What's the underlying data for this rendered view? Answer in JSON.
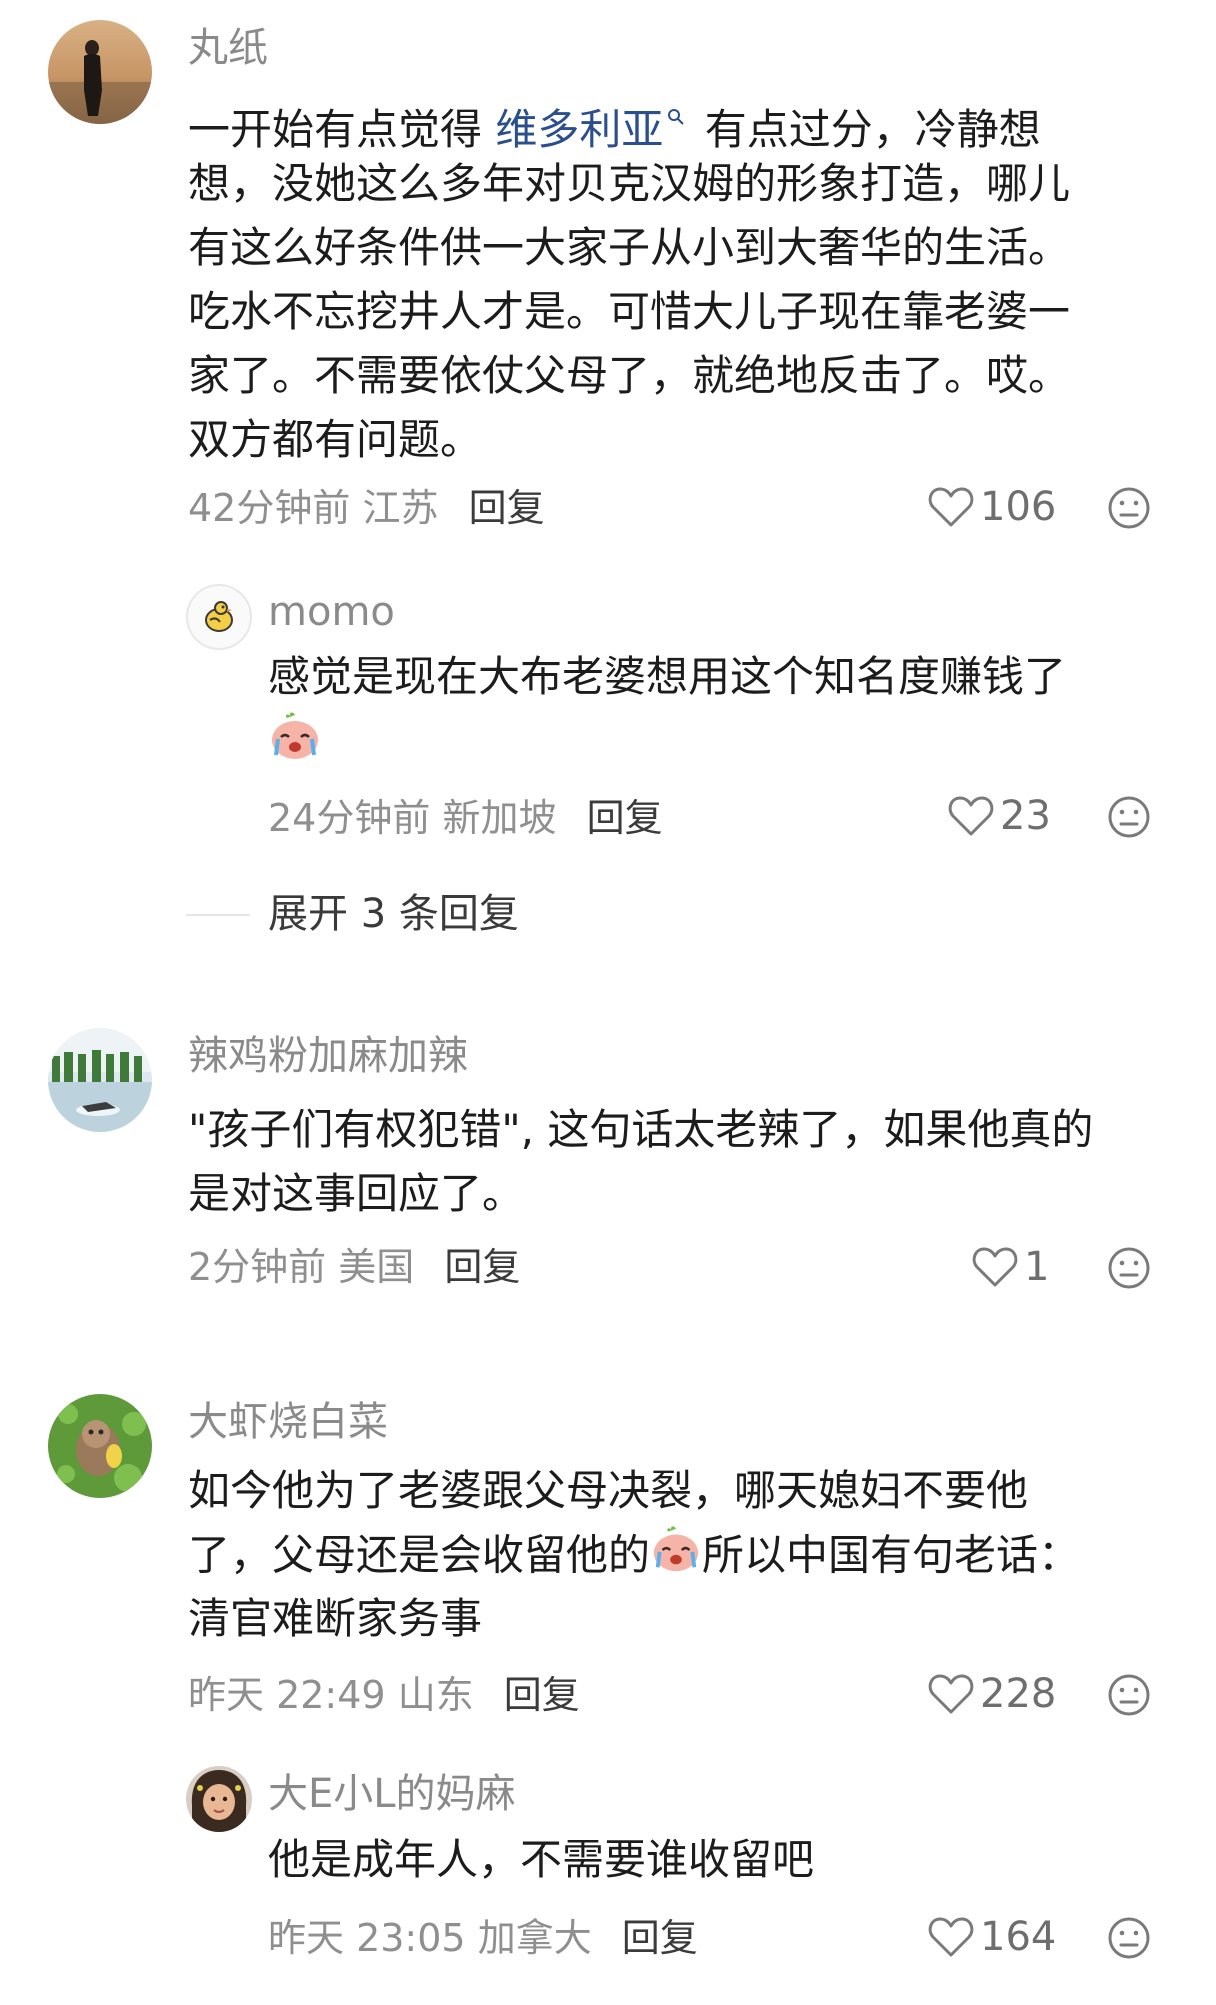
{
  "colors": {
    "background": "#ffffff",
    "username": "#8a8a8a",
    "text": "#1c1c1c",
    "meta": "#8f8f8f",
    "link": "#2b4e8c"
  },
  "comments": [
    {
      "username": "丸纸",
      "lines": [
        {
          "before": "一开始有点觉得 ",
          "link": "维多利亚",
          "after": " 有点过分，冷静想"
        },
        "想，没她这么多年对贝克汉姆的形象打造，哪儿",
        "有这么好条件供一大家子从小到大奢华的生活。",
        "吃水不忘挖井人才是。可惜大儿子现在靠老婆一",
        "家了。不需要依仗父母了，就绝地反击了。哎。",
        "双方都有问题。"
      ],
      "time": "42分钟前",
      "location": "江苏",
      "reply_label": "回复",
      "likes": "106",
      "reply": {
        "username": "momo",
        "lines": [
          "感觉是现在大布老婆想用这个知名度赚钱了"
        ],
        "emoji": "crying-face-emoji",
        "time": "24分钟前",
        "location": "新加坡",
        "reply_label": "回复",
        "likes": "23"
      },
      "expand_label": "展开 3 条回复"
    },
    {
      "username": "辣鸡粉加麻加辣",
      "lines": [
        "\"孩子们有权犯错\", 这句话太老辣了，如果他真的",
        "是对这事回应了。"
      ],
      "time": "2分钟前",
      "location": "美国",
      "reply_label": "回复",
      "likes": "1"
    },
    {
      "username": "大虾烧白菜",
      "lines": [
        "如今他为了老婆跟父母决裂，哪天媳妇不要他",
        {
          "before": "了，父母还是会收留他的",
          "emoji": "crying-face-emoji",
          "after": "所以中国有句老话："
        },
        "清官难断家务事"
      ],
      "time": "昨天 22:49",
      "location": "山东",
      "reply_label": "回复",
      "likes": "228",
      "reply": {
        "username": "大E小L的妈麻",
        "lines": [
          "他是成年人，不需要谁收留吧"
        ],
        "time": "昨天 23:05",
        "location": "加拿大",
        "reply_label": "回复",
        "likes": "164"
      }
    }
  ],
  "icons": {
    "like": "heart-outline-icon",
    "emoji_reaction": "emoji-face-icon",
    "search": "search-icon"
  }
}
